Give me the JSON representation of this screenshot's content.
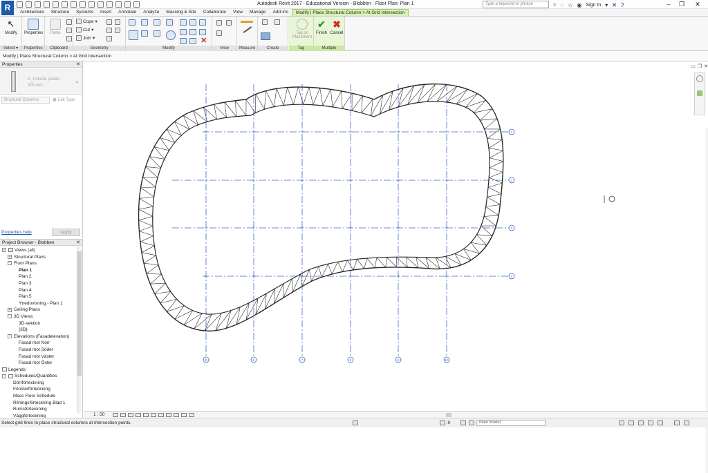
{
  "title_bar": {
    "app_logo": "R",
    "window_title": "Autodesk Revit 2017 - Educational Version -    Blobben - Floor Plan: Plan 1",
    "search_placeholder": "Type a keyword or phrase",
    "sign_in": "Sign In",
    "controls": {
      "minimize": "–",
      "restore": "❐",
      "close": "✕"
    }
  },
  "ribbon_tabs": [
    "Architecture",
    "Structure",
    "Systems",
    "Insert",
    "Annotate",
    "Analyze",
    "Massing & Site",
    "Collaborate",
    "View",
    "Manage",
    "Add-Ins",
    "Modify | Place Structural Column > At Grid Intersection"
  ],
  "active_tab_index": 11,
  "ribbon": {
    "select": {
      "label": "Modify",
      "panel": "Select ▾"
    },
    "properties": {
      "label": "Properties",
      "panel": "Properties"
    },
    "clipboard": {
      "paste": "Paste",
      "panel": "Clipboard"
    },
    "geometry": {
      "cope": "Cope",
      "cut": "Cut",
      "join": "Join",
      "panel": "Geometry"
    },
    "modify": {
      "panel": "Modify"
    },
    "view": {
      "panel": "View"
    },
    "measure": {
      "panel": "Measure"
    },
    "create": {
      "panel": "Create"
    },
    "tag": {
      "label": "Tag on Placement",
      "panel": "Tag"
    },
    "multiple": {
      "finish": "Finish",
      "cancel": "Cancel",
      "panel": "Multiple"
    }
  },
  "options_bar": "Modify | Place Structural Column > At Grid Intersection",
  "properties": {
    "title": "Properties",
    "type_name": "S_Cirkulär pelare",
    "type_size": "300 mm",
    "instance_selector": "Structural Columns",
    "edit_type": "Edit Type",
    "help_link": "Properties help",
    "apply": "Apply"
  },
  "project_browser": {
    "title": "Project Browser - Blobben",
    "items": [
      {
        "label": "Views (all)",
        "indent": 0,
        "expander": "−",
        "icon": true
      },
      {
        "label": "Structural Plans",
        "indent": 1,
        "expander": "+"
      },
      {
        "label": "Floor Plans",
        "indent": 1,
        "expander": "−"
      },
      {
        "label": "Plan 1",
        "indent": 3,
        "bold": true
      },
      {
        "label": "Plan 2",
        "indent": 3
      },
      {
        "label": "Plan 3",
        "indent": 3
      },
      {
        "label": "Plan 4",
        "indent": 3
      },
      {
        "label": "Plan 5",
        "indent": 3
      },
      {
        "label": "Ytredovisning - Plan 1",
        "indent": 3
      },
      {
        "label": "Ceiling Plans",
        "indent": 1,
        "expander": "+"
      },
      {
        "label": "3D Views",
        "indent": 1,
        "expander": "−"
      },
      {
        "label": "3D-sektion",
        "indent": 3
      },
      {
        "label": "{3D}",
        "indent": 3
      },
      {
        "label": "Elevations (Fasadelevation)",
        "indent": 1,
        "expander": "−"
      },
      {
        "label": "Fasad mot Norr",
        "indent": 3
      },
      {
        "label": "Fasad mot Söder",
        "indent": 3
      },
      {
        "label": "Fasad mot Väster",
        "indent": 3
      },
      {
        "label": "Fasad mot Öster",
        "indent": 3
      },
      {
        "label": "Legends",
        "indent": 0,
        "icon": true
      },
      {
        "label": "Schedules/Quantities",
        "indent": 0,
        "expander": "−",
        "icon": true
      },
      {
        "label": "Dörrförteckning",
        "indent": 2
      },
      {
        "label": "Fönsterförteckning",
        "indent": 2
      },
      {
        "label": "Mass Floor Schedule",
        "indent": 2
      },
      {
        "label": "Ritningsförteckning Blad 1",
        "indent": 2
      },
      {
        "label": "Rumsförteckning",
        "indent": 2
      },
      {
        "label": "Väggförteckning",
        "indent": 2
      }
    ]
  },
  "canvas": {
    "grid_lines_vertical": [
      "8",
      "6",
      "7",
      "9",
      "9",
      "10"
    ],
    "grid_lines_horizontal": [
      "1",
      "2",
      "3",
      "4"
    ],
    "colors": {
      "grid": "#3b66c4",
      "wall": "#2a2a2a"
    }
  },
  "view_bar": {
    "scale": "1 : 50"
  },
  "status_bar": {
    "message": "Select grid lines to place structural columns at intersection points.",
    "counter": ":0",
    "model": "Main Model"
  }
}
